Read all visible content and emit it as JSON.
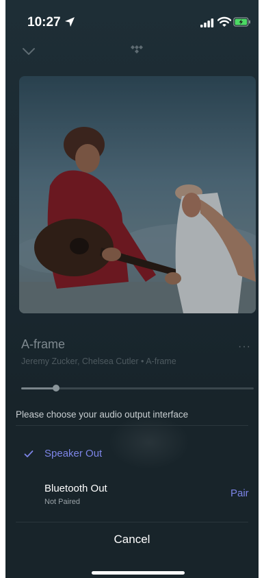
{
  "status_bar": {
    "time": "10:27",
    "location_icon": "location-arrow-icon",
    "signal_icon": "cellular-signal-icon",
    "wifi_icon": "wifi-icon",
    "battery_icon": "battery-charging-icon",
    "battery_color": "#4cd964"
  },
  "header": {
    "collapse_icon": "chevron-down-icon",
    "app_icon": "tidal-logo-icon"
  },
  "track": {
    "title": "A-frame",
    "subtitle": "Jeremy Zucker, Chelsea Cutler • A-frame",
    "more_label": "···",
    "progress": 0.15
  },
  "sheet": {
    "title": "Please choose your audio output interface",
    "options": [
      {
        "label": "Speaker Out",
        "selected": true,
        "icon": "checkmark-icon"
      },
      {
        "label": "Bluetooth Out",
        "sublabel": "Not Paired",
        "action": "Pair"
      }
    ],
    "cancel_label": "Cancel"
  },
  "colors": {
    "accent": "#7d85e8",
    "sheet_background": "#18242a"
  }
}
